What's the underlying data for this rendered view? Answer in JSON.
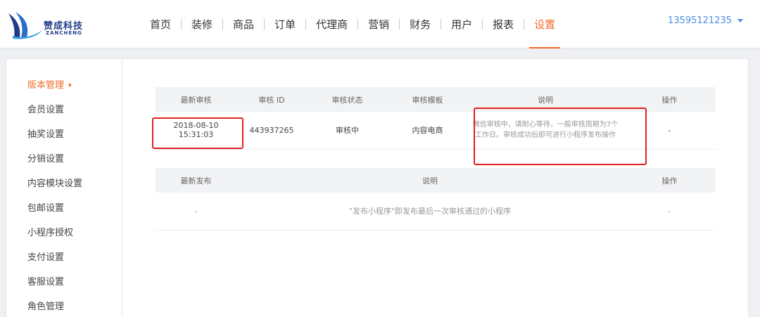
{
  "brand": {
    "name_cn": "赞成科技",
    "name_en": "ZANCHENG"
  },
  "nav": {
    "items": [
      "首页",
      "装修",
      "商品",
      "订单",
      "代理商",
      "营销",
      "财务",
      "用户",
      "报表",
      "设置"
    ],
    "active": "设置"
  },
  "user": {
    "phone": "13595121235"
  },
  "sidebar": {
    "items": [
      "版本管理",
      "会员设置",
      "抽奖设置",
      "分销设置",
      "内容模块设置",
      "包邮设置",
      "小程序授权",
      "支付设置",
      "客服设置",
      "角色管理"
    ],
    "active": "版本管理"
  },
  "audit_table": {
    "headers": [
      "最新审核",
      "审核 ID",
      "审核状态",
      "审核模板",
      "说明",
      "操作"
    ],
    "row": {
      "time": "2018-08-10 15:31:03",
      "id": "443937265",
      "status": "审核中",
      "template": "内容电商",
      "note_line1": "微信审核中，请耐心等待，一般审核周期为7个",
      "note_line2": "工作日。审核成功后即可进行小程序发布操作",
      "action": "-"
    }
  },
  "release_table": {
    "headers": [
      "最新发布",
      "说明",
      "操作"
    ],
    "row": {
      "release": "-",
      "note": "\"发布小程序\"即发布最后一次审核通过的小程序",
      "action": "-"
    }
  },
  "colors": {
    "accent": "#f06b29",
    "link": "#4a90e2",
    "highlight": "#e02020",
    "brand": "#1f3c8a"
  }
}
